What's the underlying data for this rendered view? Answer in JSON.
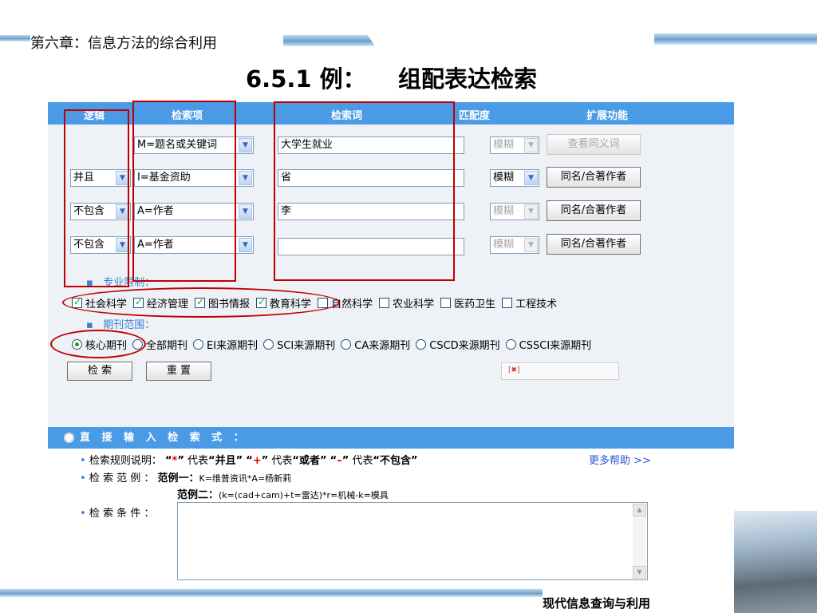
{
  "slide": {
    "chapter": "第六章：信息方法的综合利用",
    "title": "6.5.1 例：    组配表达检索",
    "footer": "现代信息查询与利用"
  },
  "header": {
    "logic": "逻辑",
    "field": "检索项",
    "term": "检索词",
    "match": "匹配度",
    "extend": "扩展功能"
  },
  "rows": [
    {
      "logic": "",
      "field": "M=题名或关键词",
      "term": "大学生就业",
      "match": "模糊",
      "action": "查看同义词"
    },
    {
      "logic": "并且",
      "field": "I=基金资助",
      "term": "省",
      "match": "模糊",
      "action": "同名/合著作者"
    },
    {
      "logic": "不包含",
      "field": "A=作者",
      "term": "李",
      "match": "模糊",
      "action": "同名/合著作者"
    },
    {
      "logic": "不包含",
      "field": "A=作者",
      "term": "",
      "match": "模糊",
      "action": "同名/合著作者"
    }
  ],
  "subject_limit": {
    "label": "专业限制：",
    "items": [
      "社会科学",
      "经济管理",
      "图书情报",
      "教育科学",
      "自然科学",
      "农业科学",
      "医药卫生",
      "工程技术"
    ],
    "checked": [
      true,
      true,
      true,
      true,
      false,
      false,
      false,
      false
    ]
  },
  "journal_scope": {
    "label": "期刊范围：",
    "items": [
      "核心期刊",
      "全部期刊",
      "EI来源期刊",
      "SCI来源期刊",
      "CA来源期刊",
      "CSCD来源期刊",
      "CSSCI来源期刊"
    ],
    "selected": 0
  },
  "buttons": {
    "search": "检 索",
    "reset": "重 置"
  },
  "direct": {
    "title": "直 接 输 入 检 索 式 ：",
    "rules_label": "检索规则说明：",
    "rules_q1": "“",
    "rules_star": "*",
    "rules_q2": "”",
    "rules_and_text": "代表",
    "rules_and": "“并且”",
    "rules_q3": "“",
    "rules_plus": "+",
    "rules_q4": "”",
    "rules_or_text": "代表",
    "rules_or": "“或者”",
    "rules_q5": "“",
    "rules_minus": "–",
    "rules_q6": "”",
    "rules_not_text": "代表",
    "rules_not": "“不包含”",
    "more_help": "更多帮助 >>",
    "example_label": "检 索 范 例 ：",
    "example1_label": "范例一：",
    "example1": "K=维普资讯*A=杨新莉",
    "example2_label": "范例二：",
    "example2": "(k=(cad+cam)+t=雷达)*r=机械-k=模具",
    "condition_label": "检 索 条 件 ："
  }
}
